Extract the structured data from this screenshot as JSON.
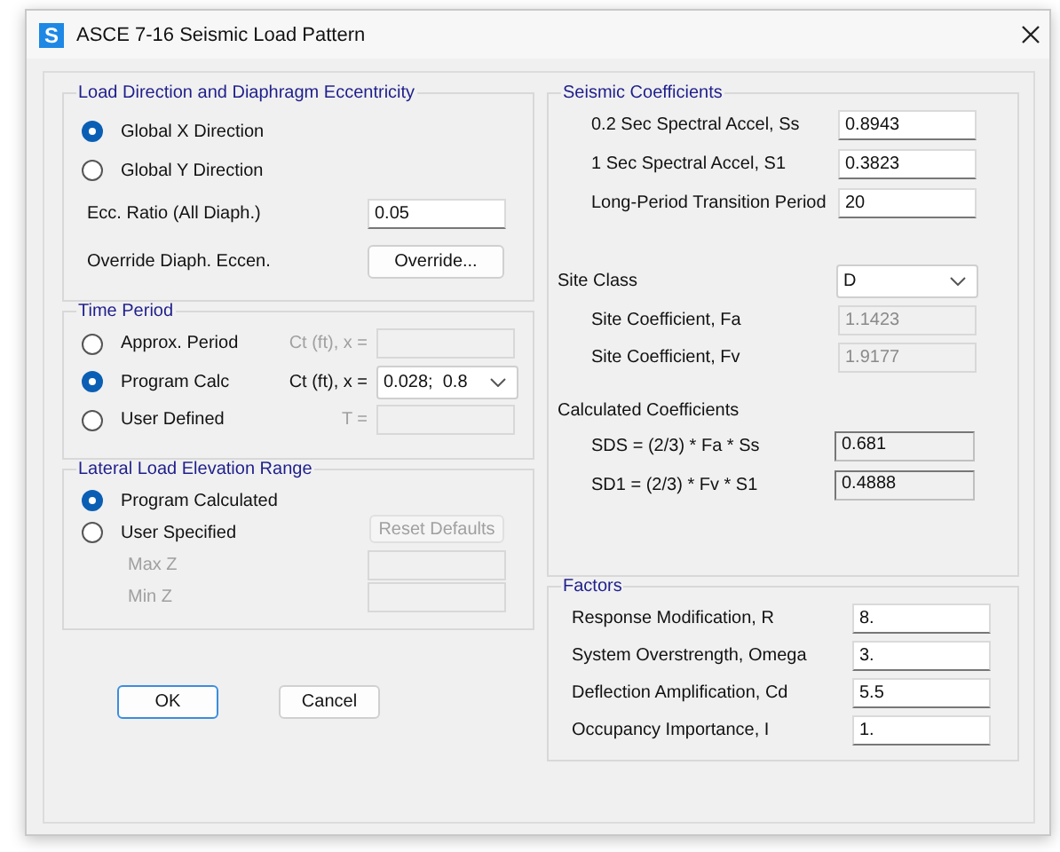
{
  "window": {
    "icon_letter": "S",
    "title": "ASCE 7-16 Seismic Load Pattern"
  },
  "load_direction": {
    "legend": "Load Direction and Diaphragm Eccentricity",
    "options": [
      {
        "label": "Global  X  Direction",
        "selected": true
      },
      {
        "label": "Global  Y  Direction",
        "selected": false
      }
    ],
    "ecc_ratio": {
      "label": "Ecc. Ratio (All Diaph.)",
      "value": "0.05"
    },
    "override": {
      "label": "Override Diaph. Eccen.",
      "button": "Override..."
    }
  },
  "time_period": {
    "legend": "Time Period",
    "options": [
      {
        "label": "Approx. Period",
        "selected": false,
        "field_label": "Ct (ft), x =",
        "kind": "input",
        "disabled": true
      },
      {
        "label": "Program Calc",
        "selected": true,
        "field_label": "Ct (ft), x =",
        "kind": "dropdown",
        "value": "0.028;  0.8",
        "disabled": false
      },
      {
        "label": "User Defined",
        "selected": false,
        "field_label": "T =",
        "kind": "input",
        "disabled": true
      }
    ]
  },
  "elevation_range": {
    "legend": "Lateral Load Elevation Range",
    "options": [
      {
        "label": "Program Calculated",
        "selected": true
      },
      {
        "label": "User Specified",
        "selected": false
      }
    ],
    "reset_button": {
      "label": "Reset Defaults",
      "disabled": true
    },
    "fields": [
      {
        "label": "Max Z",
        "disabled": true
      },
      {
        "label": "Min Z",
        "disabled": true
      }
    ]
  },
  "buttons": [
    {
      "label": "OK",
      "default": true
    },
    {
      "label": "Cancel",
      "default": false
    }
  ],
  "seismic_coefficients": {
    "legend": "Seismic Coefficients",
    "fields": [
      {
        "label": "0.2 Sec Spectral Accel, Ss",
        "value": "0.8943"
      },
      {
        "label": "1 Sec Spectral Accel, S1",
        "value": "0.3823"
      },
      {
        "label": "Long-Period Transition Period",
        "value": "20"
      }
    ],
    "site_class": {
      "label": "Site Class",
      "value": "D"
    },
    "site_coefficients": [
      {
        "label": "Site Coefficient, Fa",
        "value": "1.1423",
        "disabled": true
      },
      {
        "label": "Site Coefficient, Fv",
        "value": "1.9177",
        "disabled": true
      }
    ],
    "calculated": {
      "heading": "Calculated Coefficients",
      "rows": [
        {
          "label": "SDS = (2/3) * Fa * Ss",
          "value": "0.681"
        },
        {
          "label": "SD1 = (2/3) * Fv * S1",
          "value": "0.4888"
        }
      ]
    }
  },
  "factors": {
    "legend": "Factors",
    "fields": [
      {
        "label": "Response Modification, R",
        "value": "8."
      },
      {
        "label": "System Overstrength, Omega",
        "value": "3."
      },
      {
        "label": "Deflection Amplification, Cd",
        "value": "5.5"
      },
      {
        "label": "Occupancy Importance, I",
        "value": "1."
      }
    ]
  }
}
